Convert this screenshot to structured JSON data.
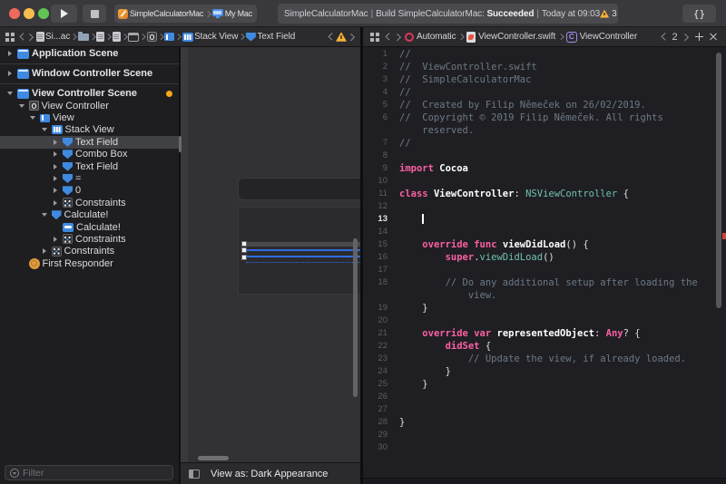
{
  "colors": {
    "accent_blue": "#3F8AE0",
    "selection_blue": "#2F6BE4",
    "keyword_pink": "#FC5FA3",
    "type_teal": "#6FC1AC",
    "comment_gray": "#6C7986",
    "warning_yellow": "#F7B239"
  },
  "toolbar": {
    "scheme": {
      "app": "SimpleCalculatorMac",
      "destination": "My Mac"
    },
    "status": {
      "project": "SimpleCalculatorMac",
      "sep": "|",
      "build_prefix": "Build SimpleCalculatorMac:",
      "result": "Succeeded",
      "time": "Today at 09:03",
      "warning_count": "3"
    },
    "library_label": "{}"
  },
  "ib_jumpbar": {
    "path": [
      {
        "icon": "doc",
        "label": "Si...ac"
      },
      {
        "icon": "folder",
        "label": ""
      },
      {
        "icon": "doc",
        "label": ""
      },
      {
        "icon": "doc",
        "label": ""
      },
      {
        "icon": "winitem",
        "label": ""
      },
      {
        "icon": "circleitem",
        "label": ""
      },
      {
        "icon": "splititem",
        "label": ""
      },
      {
        "icon": "stack",
        "label": "Stack View"
      },
      {
        "icon": "field",
        "label": "Text Field"
      }
    ]
  },
  "editor_jumpbar": {
    "path": [
      {
        "icon": "auto",
        "label": "Automatic"
      },
      {
        "icon": "swift",
        "label": "ViewController.swift"
      },
      {
        "icon": "cbox",
        "icon_letter": "C",
        "label": "ViewController"
      }
    ],
    "counter": "2"
  },
  "outline": {
    "rows": [
      {
        "label": "Application Scene",
        "icon": "scene",
        "disclosure": "right",
        "depth": 0,
        "scene": true,
        "separator_after": true
      },
      {
        "label": "Window Controller Scene",
        "icon": "scene",
        "disclosure": "right",
        "depth": 0,
        "scene": true,
        "separator_after": true
      },
      {
        "label": "View Controller Scene",
        "icon": "scene",
        "disclosure": "down",
        "depth": 0,
        "scene": true,
        "badge": "warning-dot"
      },
      {
        "label": "View Controller",
        "icon": "vc",
        "disclosure": "down",
        "depth": 1
      },
      {
        "label": "View",
        "icon": "view",
        "disclosure": "down",
        "depth": 2
      },
      {
        "label": "Stack View",
        "icon": "stack",
        "disclosure": "down",
        "depth": 3
      },
      {
        "label": "Text Field",
        "icon": "field",
        "disclosure": "right",
        "depth": 4,
        "selected": true
      },
      {
        "label": "Combo Box",
        "icon": "field",
        "disclosure": "right",
        "depth": 4
      },
      {
        "label": "Text Field",
        "icon": "field",
        "disclosure": "right",
        "depth": 4
      },
      {
        "label": "=",
        "icon": "field",
        "disclosure": "right",
        "depth": 4
      },
      {
        "label": "0",
        "icon": "field",
        "disclosure": "right",
        "depth": 4
      },
      {
        "label": "Constraints",
        "icon": "constraints",
        "disclosure": "right",
        "depth": 4
      },
      {
        "label": "Calculate!",
        "icon": "field",
        "disclosure": "down",
        "depth": 3
      },
      {
        "label": "Calculate!",
        "icon": "button",
        "disclosure": "none",
        "depth": 4
      },
      {
        "label": "Constraints",
        "icon": "constraints",
        "disclosure": "right",
        "depth": 4
      },
      {
        "label": "Constraints",
        "icon": "constraints",
        "disclosure": "right",
        "depth": 3
      },
      {
        "label": "First Responder",
        "icon": "fr",
        "disclosure": "none",
        "depth": 1
      }
    ]
  },
  "filter_bar": {
    "placeholder": "Filter"
  },
  "canvas_bar": {
    "label": "View as: Dark Appearance"
  },
  "code": {
    "lines": [
      {
        "n": "1",
        "segs": [
          [
            "c",
            "//"
          ]
        ]
      },
      {
        "n": "2",
        "segs": [
          [
            "c",
            "//  ViewController.swift"
          ]
        ]
      },
      {
        "n": "3",
        "segs": [
          [
            "c",
            "//  SimpleCalculatorMac"
          ]
        ]
      },
      {
        "n": "4",
        "segs": [
          [
            "c",
            "//"
          ]
        ]
      },
      {
        "n": "5",
        "segs": [
          [
            "c",
            "//  Created by Filip Němeček on 26/02/2019."
          ]
        ]
      },
      {
        "n": "6",
        "segs": [
          [
            "c",
            "//  Copyright © 2019 Filip Němeček. All rights"
          ]
        ]
      },
      {
        "n": "",
        "segs": [
          [
            "c",
            "    reserved."
          ]
        ]
      },
      {
        "n": "7",
        "segs": [
          [
            "c",
            "//"
          ]
        ]
      },
      {
        "n": "8",
        "segs": []
      },
      {
        "n": "9",
        "segs": [
          [
            "k",
            "import"
          ],
          [
            "p",
            " "
          ],
          [
            "pb",
            "Cocoa"
          ]
        ]
      },
      {
        "n": "10",
        "segs": []
      },
      {
        "n": "11",
        "segs": [
          [
            "k",
            "class"
          ],
          [
            "p",
            " "
          ],
          [
            "pb",
            "ViewController"
          ],
          [
            "p",
            ": "
          ],
          [
            "t",
            "NSViewController"
          ],
          [
            "p",
            " {"
          ]
        ]
      },
      {
        "n": "12",
        "segs": []
      },
      {
        "n": "13",
        "current": true,
        "segs": [
          [
            "p",
            "    "
          ],
          [
            "caret",
            ""
          ]
        ]
      },
      {
        "n": "14",
        "segs": []
      },
      {
        "n": "15",
        "segs": [
          [
            "p",
            "    "
          ],
          [
            "k",
            "override"
          ],
          [
            "p",
            " "
          ],
          [
            "k",
            "func"
          ],
          [
            "p",
            " "
          ],
          [
            "pb",
            "viewDidLoad"
          ],
          [
            "p",
            "() {"
          ]
        ]
      },
      {
        "n": "16",
        "segs": [
          [
            "p",
            "        "
          ],
          [
            "k",
            "super"
          ],
          [
            "p",
            "."
          ],
          [
            "t",
            "viewDidLoad"
          ],
          [
            "p",
            "()"
          ]
        ]
      },
      {
        "n": "17",
        "segs": []
      },
      {
        "n": "18",
        "segs": [
          [
            "c",
            "        // Do any additional setup after loading the"
          ]
        ]
      },
      {
        "n": "",
        "segs": [
          [
            "c",
            "            view."
          ]
        ]
      },
      {
        "n": "19",
        "segs": [
          [
            "p",
            "    }"
          ]
        ]
      },
      {
        "n": "20",
        "segs": []
      },
      {
        "n": "21",
        "segs": [
          [
            "p",
            "    "
          ],
          [
            "k",
            "override"
          ],
          [
            "p",
            " "
          ],
          [
            "k",
            "var"
          ],
          [
            "p",
            " "
          ],
          [
            "pb",
            "representedObject"
          ],
          [
            "p",
            ": "
          ],
          [
            "k",
            "Any"
          ],
          [
            "p",
            "? {"
          ]
        ]
      },
      {
        "n": "22",
        "segs": [
          [
            "p",
            "        "
          ],
          [
            "k",
            "didSet"
          ],
          [
            "p",
            " {"
          ]
        ]
      },
      {
        "n": "23",
        "segs": [
          [
            "c",
            "            // Update the view, if already loaded."
          ]
        ]
      },
      {
        "n": "24",
        "segs": [
          [
            "p",
            "        }"
          ]
        ]
      },
      {
        "n": "25",
        "segs": [
          [
            "p",
            "    }"
          ]
        ]
      },
      {
        "n": "26",
        "segs": []
      },
      {
        "n": "27",
        "segs": []
      },
      {
        "n": "28",
        "segs": [
          [
            "p",
            "}"
          ]
        ]
      },
      {
        "n": "29",
        "segs": []
      },
      {
        "n": "30",
        "segs": []
      }
    ]
  }
}
